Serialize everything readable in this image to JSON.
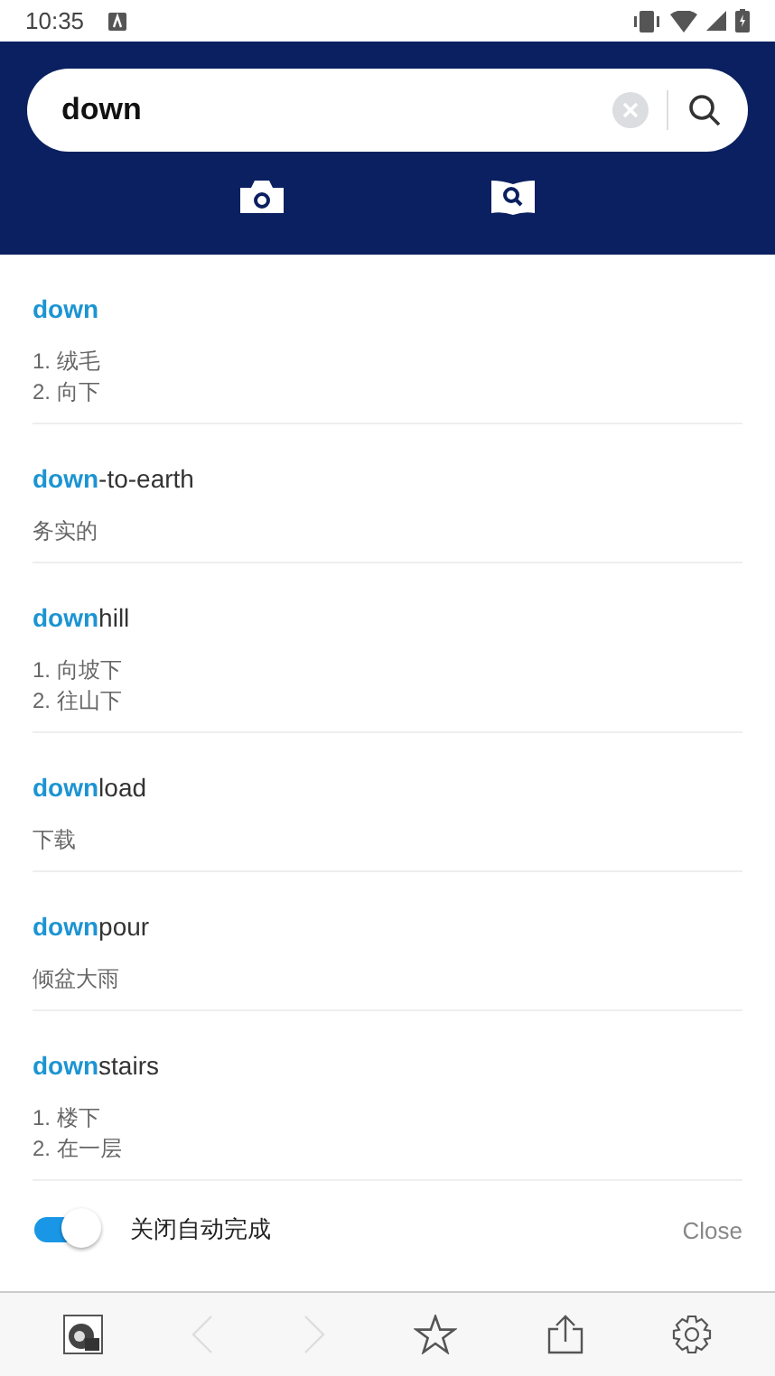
{
  "status_bar": {
    "time": "10:35"
  },
  "search": {
    "value": "down"
  },
  "results": [
    {
      "headword": "**down**",
      "senses": [
        "1. 绒毛",
        "2. 向下"
      ]
    },
    {
      "headword": "**down**-to-earth",
      "senses": [
        "务实的"
      ]
    },
    {
      "headword": "**down**hill",
      "senses": [
        "1. 向坡下",
        "2. 往山下"
      ]
    },
    {
      "headword": "**down**load",
      "senses": [
        "下载"
      ]
    },
    {
      "headword": "**down**pour",
      "senses": [
        "倾盆大雨"
      ]
    },
    {
      "headword": "**down**stairs",
      "senses": [
        "1. 楼下",
        "2. 在一层"
      ]
    }
  ],
  "autocomplete": {
    "on": true,
    "label": "关闭自动完成",
    "close": "Close"
  },
  "toolbar": [
    {
      "kind": "logo",
      "disabled": false
    },
    {
      "kind": "back",
      "disabled": true
    },
    {
      "kind": "forward",
      "disabled": true
    },
    {
      "kind": "star",
      "disabled": false
    },
    {
      "kind": "share",
      "disabled": false
    },
    {
      "kind": "settings",
      "disabled": false
    }
  ]
}
